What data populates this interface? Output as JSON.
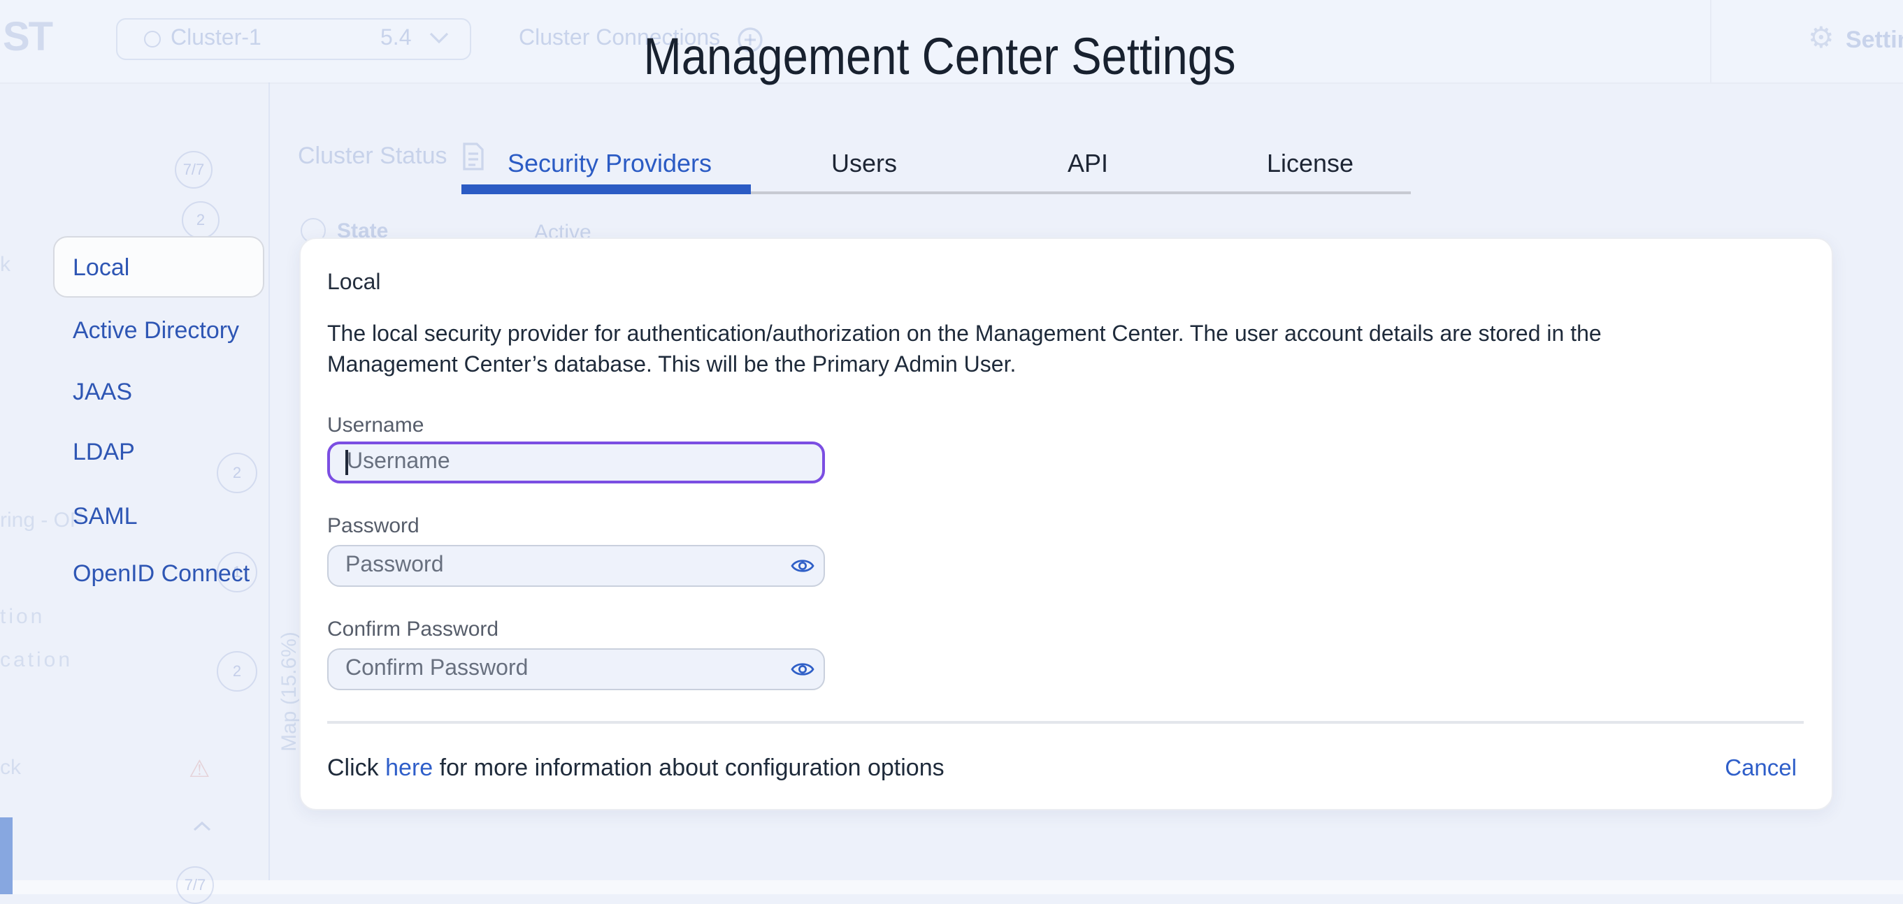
{
  "colors": {
    "accent_blue": "#2b5bc4",
    "link_blue": "#2e5ec9",
    "sidebar_blue": "#2e56b4",
    "focus_purple": "#7b4ee2",
    "page_background": "#edf1fa",
    "card_background": "#ffffff",
    "input_background": "#eef2fb"
  },
  "ghost": {
    "logo": "ST",
    "cluster_name": "Cluster-1",
    "cluster_version": "5.4",
    "cluster_connections": "Cluster Connections",
    "settings": "Settin",
    "cluster_status": "Cluster Status",
    "state": "State",
    "active": "Active",
    "badge_top": "7/7",
    "badge_2a": "2",
    "badge_2b": "2",
    "badge_1": "1",
    "badge_2c": "2",
    "badge_bottom": "7/7",
    "frag_k": "k",
    "frag_ring": "ring - OF",
    "frag_tion": "tion",
    "frag_cation": "cation",
    "frag_ck": "ck",
    "map_label": "Map (15.6%)"
  },
  "modal": {
    "title": "Management Center Settings",
    "tabs": [
      {
        "label": "Security Providers",
        "active": true
      },
      {
        "label": "Users",
        "active": false
      },
      {
        "label": "API",
        "active": false
      },
      {
        "label": "License",
        "active": false
      }
    ],
    "sidebar": [
      {
        "label": "Local",
        "selected": true
      },
      {
        "label": "Active Directory",
        "selected": false
      },
      {
        "label": "JAAS",
        "selected": false
      },
      {
        "label": "LDAP",
        "selected": false
      },
      {
        "label": "SAML",
        "selected": false
      },
      {
        "label": "OpenID Connect",
        "selected": false
      }
    ],
    "panel": {
      "heading": "Local",
      "description_line1": "The local security provider for authentication/authorization on the Management Center. The user account details are stored in the",
      "description_line2": "Management Center’s database. This will be the Primary Admin User.",
      "fields": [
        {
          "label": "Username",
          "placeholder": "Username",
          "value": "",
          "focused": true
        },
        {
          "label": "Password",
          "placeholder": "Password",
          "value": "",
          "focused": false
        },
        {
          "label": "Confirm Password",
          "placeholder": "Confirm Password",
          "value": "",
          "focused": false
        }
      ],
      "footer": {
        "text_before": "Click ",
        "link": "here",
        "text_after": " for more information about configuration options",
        "cancel": "Cancel"
      }
    }
  }
}
